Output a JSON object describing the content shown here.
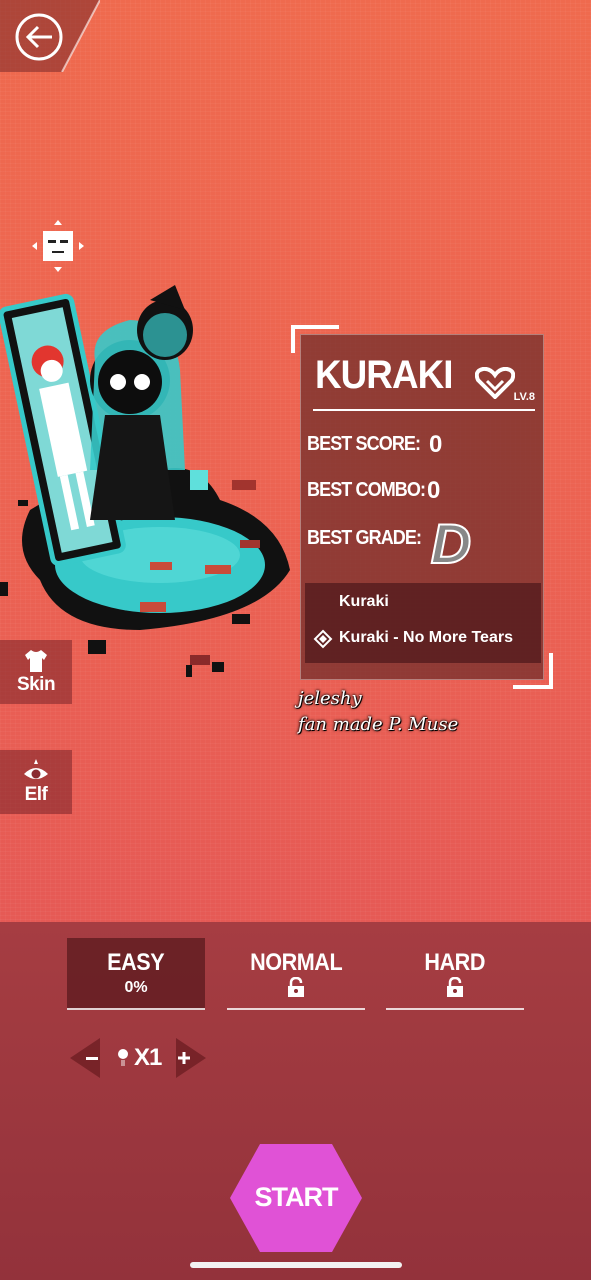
{
  "song": {
    "title": "KURAKI",
    "level": "LV.8",
    "best_score_label": "BEST SCORE:",
    "best_score": "0",
    "best_combo_label": "BEST COMBO:",
    "best_combo": "0",
    "best_grade_label": "BEST GRADE:",
    "best_grade": "D",
    "charts": [
      "Kuraki",
      "Kuraki - No More Tears"
    ]
  },
  "credits": {
    "author": "jeleshy",
    "note": "fan made P. Muse"
  },
  "side_buttons": {
    "skin": "Skin",
    "elf": "Elf"
  },
  "difficulties": [
    {
      "name": "EASY",
      "progress": "0%",
      "locked": false,
      "selected": true
    },
    {
      "name": "NORMAL",
      "locked": true,
      "selected": false
    },
    {
      "name": "HARD",
      "locked": true,
      "selected": false
    }
  ],
  "speed": {
    "value": "X1"
  },
  "start_label": "START",
  "colors": {
    "background": "#ec6352",
    "start_button": "#e052d6",
    "accent_teal": "#37c9c9"
  },
  "icons": [
    "back-arrow-icon",
    "emote-icon",
    "shirt-icon",
    "eye-icon",
    "heart-icon",
    "lock-icon",
    "minus-icon",
    "plus-icon"
  ]
}
